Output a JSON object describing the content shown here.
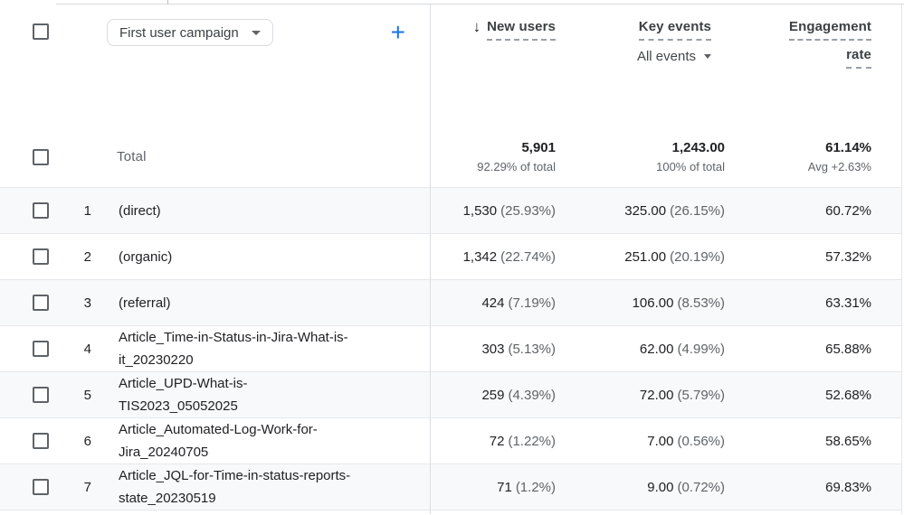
{
  "colors": {
    "accent_blue": "#1a73e8",
    "text_primary": "#202124",
    "text_secondary": "#5f6368",
    "row_alt_bg": "#f8f9fa",
    "row_border": "#e5e7ea",
    "pane_divider": "#dadce0"
  },
  "toolbar": {
    "dimension_label": "First user campaign",
    "add_label": "+"
  },
  "columns": {
    "new_users": {
      "label": "New users",
      "sort_icon": "↓"
    },
    "key_events": {
      "label": "Key events",
      "filter_label": "All events"
    },
    "engagement_rate": {
      "line1": "Engagement",
      "line2": "rate"
    }
  },
  "totals": {
    "label": "Total",
    "new_users": "5,901",
    "new_users_sub": "92.29% of total",
    "key_events": "1,243.00",
    "key_events_sub": "100% of total",
    "engagement_rate": "61.14%",
    "engagement_rate_sub": "Avg +2.63%"
  },
  "rows": [
    {
      "index": "1",
      "name": "(direct)",
      "lines": [
        "(direct)"
      ],
      "new_users": "1,530",
      "new_users_pct": "(25.93%)",
      "key_events": "325.00",
      "key_events_pct": "(26.15%)",
      "engagement_rate": "60.72%"
    },
    {
      "index": "2",
      "name": "(organic)",
      "lines": [
        "(organic)"
      ],
      "new_users": "1,342",
      "new_users_pct": "(22.74%)",
      "key_events": "251.00",
      "key_events_pct": "(20.19%)",
      "engagement_rate": "57.32%"
    },
    {
      "index": "3",
      "name": "(referral)",
      "lines": [
        "(referral)"
      ],
      "new_users": "424",
      "new_users_pct": "(7.19%)",
      "key_events": "106.00",
      "key_events_pct": "(8.53%)",
      "engagement_rate": "63.31%"
    },
    {
      "index": "4",
      "name": "Article_Time-in-Status-in-Jira-What-is-it_20230220",
      "lines": [
        "Article_Time-in-Status-in-Jira-What-is-",
        "it_20230220"
      ],
      "new_users": "303",
      "new_users_pct": "(5.13%)",
      "key_events": "62.00",
      "key_events_pct": "(4.99%)",
      "engagement_rate": "65.88%"
    },
    {
      "index": "5",
      "name": "Article_UPD-What-is-TIS2023_05052025",
      "lines": [
        "Article_UPD-What-is-",
        "TIS2023_05052025"
      ],
      "new_users": "259",
      "new_users_pct": "(4.39%)",
      "key_events": "72.00",
      "key_events_pct": "(5.79%)",
      "engagement_rate": "52.68%"
    },
    {
      "index": "6",
      "name": "Article_Automated-Log-Work-for-Jira_20240705",
      "lines": [
        "Article_Automated-Log-Work-for-",
        "Jira_20240705"
      ],
      "new_users": "72",
      "new_users_pct": "(1.22%)",
      "key_events": "7.00",
      "key_events_pct": "(0.56%)",
      "engagement_rate": "58.65%"
    },
    {
      "index": "7",
      "name": "Article_JQL-for-Time-in-status-reports-state_20230519",
      "lines": [
        "Article_JQL-for-Time-in-status-reports-",
        "state_20230519"
      ],
      "new_users": "71",
      "new_users_pct": "(1.2%)",
      "key_events": "9.00",
      "key_events_pct": "(0.72%)",
      "engagement_rate": "69.83%"
    }
  ]
}
